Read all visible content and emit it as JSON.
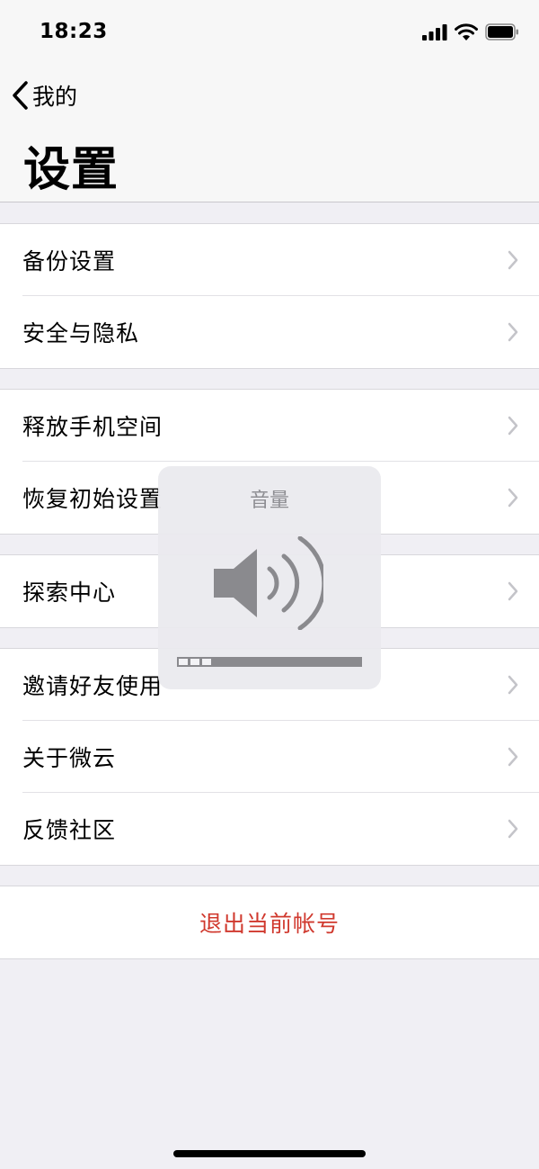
{
  "status_bar": {
    "time": "18:23",
    "icons": [
      "cellular-signal-icon",
      "wifi-icon",
      "battery-icon"
    ]
  },
  "nav": {
    "back_label": "我的",
    "title": "设置"
  },
  "groups": [
    {
      "items": [
        {
          "label": "备份设置"
        },
        {
          "label": "安全与隐私"
        }
      ]
    },
    {
      "items": [
        {
          "label": "释放手机空间"
        },
        {
          "label": "恢复初始设置"
        }
      ]
    },
    {
      "items": [
        {
          "label": "探索中心"
        }
      ]
    },
    {
      "items": [
        {
          "label": "邀请好友使用"
        },
        {
          "label": "关于微云"
        },
        {
          "label": "反馈社区"
        }
      ]
    }
  ],
  "logout": {
    "label": "退出当前帐号"
  },
  "volume_hud": {
    "title": "音量",
    "level_segments": 3,
    "total_segments": 16
  },
  "colors": {
    "background": "#f0eff4",
    "destructive": "#d0392e",
    "chevron": "#c4c4c9",
    "separator": "#e2e1e6"
  }
}
